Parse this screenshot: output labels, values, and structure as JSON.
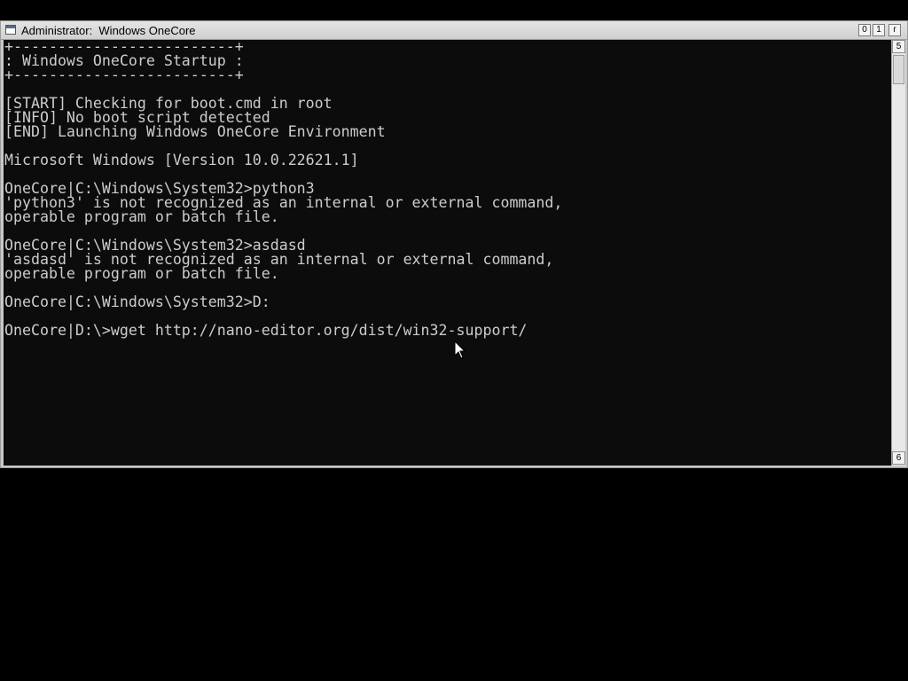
{
  "window": {
    "title": "Administrator:  Windows OneCore",
    "buttons": {
      "minimize": "0",
      "maximize": "1",
      "close": "r"
    }
  },
  "scrollbar": {
    "up_arrow": "5",
    "down_arrow": "6"
  },
  "console": {
    "lines": [
      "+-------------------------+",
      ": Windows OneCore Startup :",
      "+-------------------------+",
      "",
      "[START] Checking for boot.cmd in root",
      "[INFO] No boot script detected",
      "[END] Launching Windows OneCore Environment",
      "",
      "Microsoft Windows [Version 10.0.22621.1]",
      "",
      "OneCore|C:\\Windows\\System32>python3",
      "'python3' is not recognized as an internal or external command,",
      "operable program or batch file.",
      "",
      "OneCore|C:\\Windows\\System32>asdasd",
      "'asdasd' is not recognized as an internal or external command,",
      "operable program or batch file.",
      "",
      "OneCore|C:\\Windows\\System32>D:",
      "",
      "OneCore|D:\\>wget http://nano-editor.org/dist/win32-support/"
    ]
  },
  "colors": {
    "console_background": "#0c0c0c",
    "console_text": "#cccccc",
    "desktop": "#000000"
  },
  "icons": [
    "system-menu-icon",
    "mouse-pointer-icon"
  ]
}
